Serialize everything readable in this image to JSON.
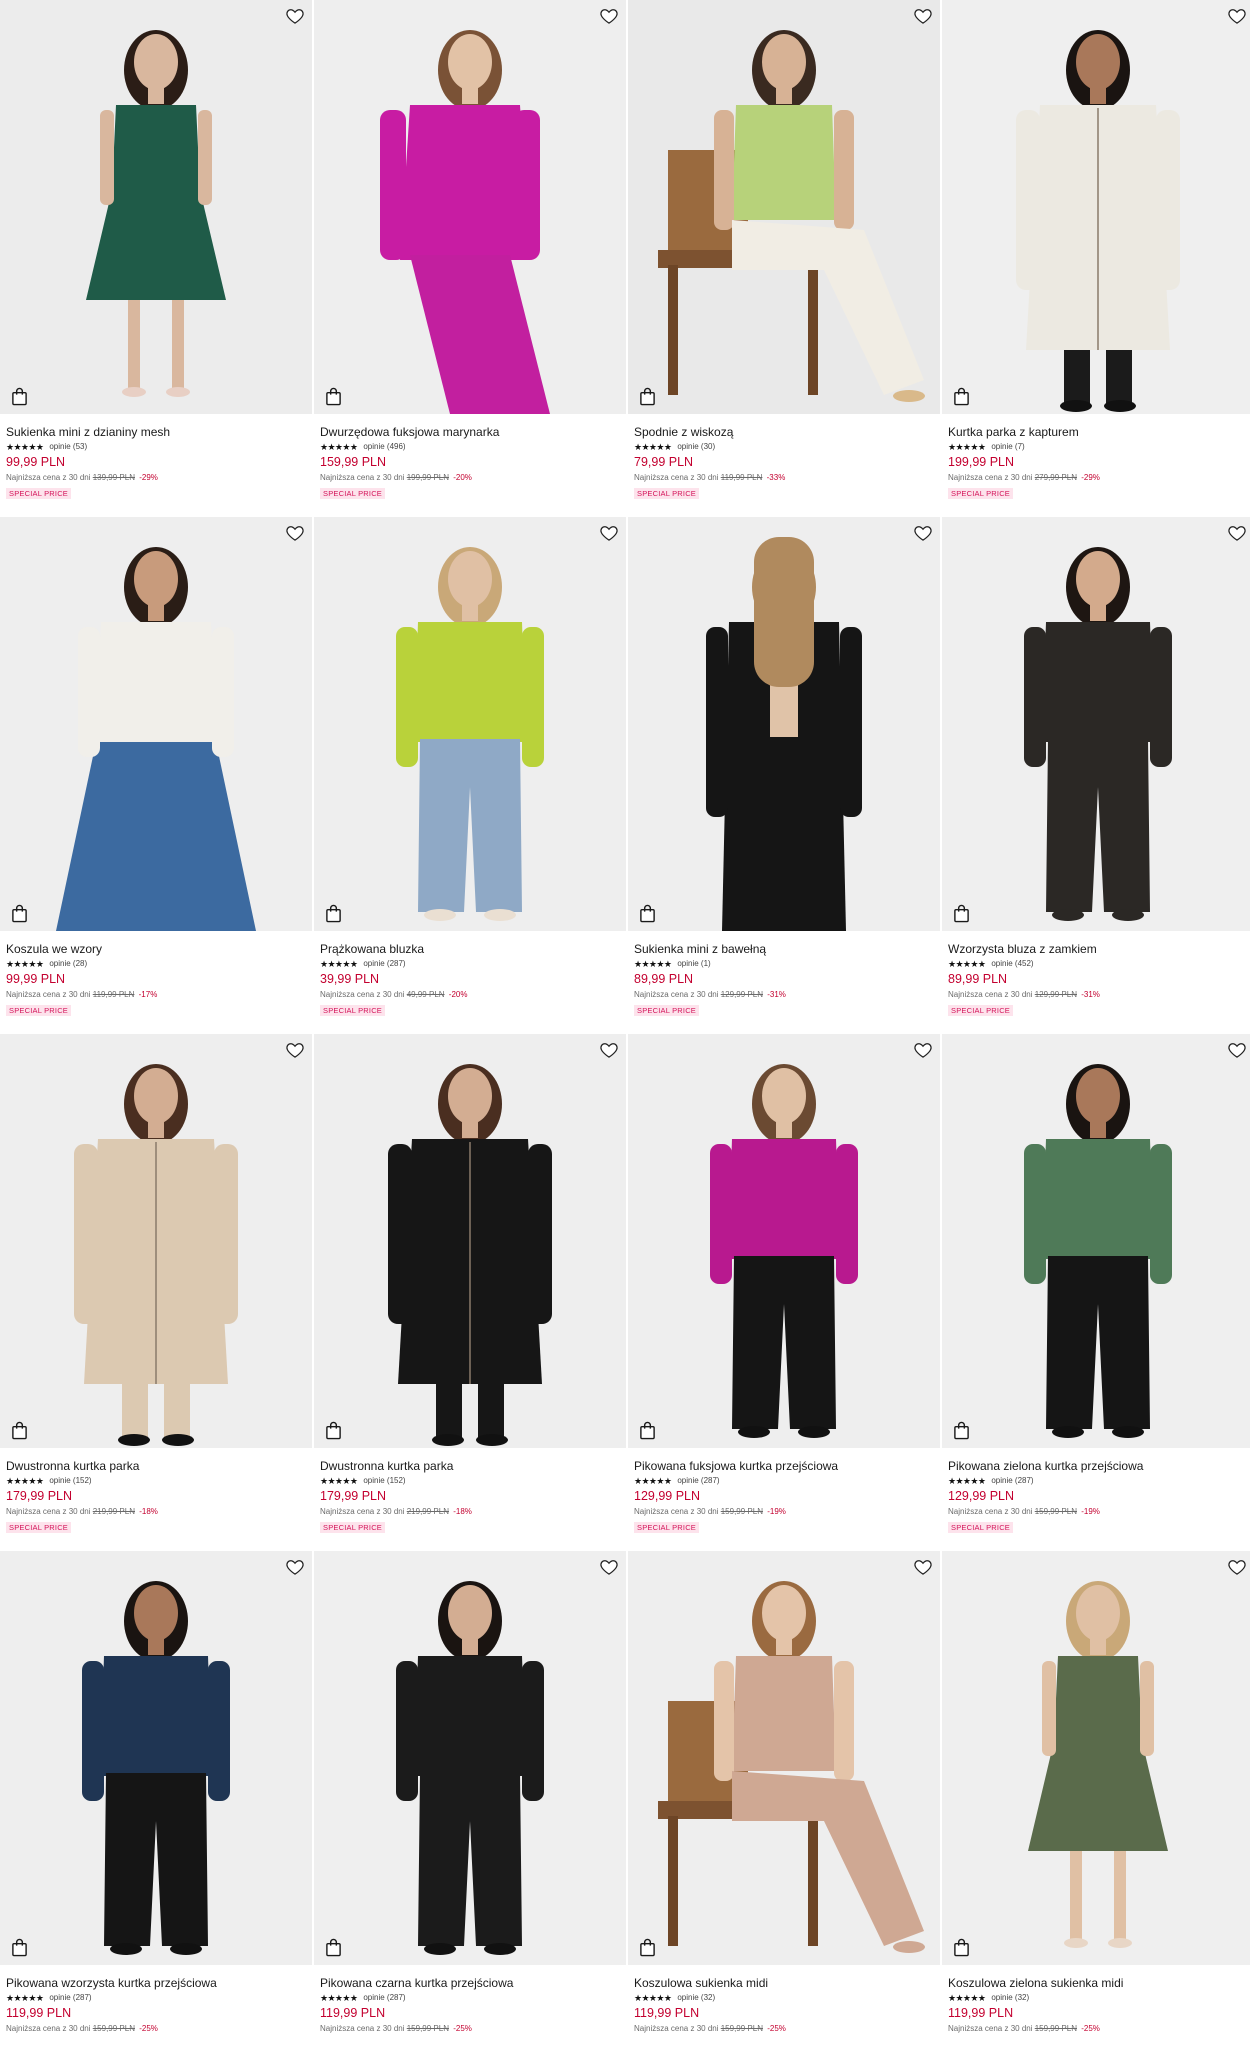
{
  "colors": {
    "price": "#c3002f",
    "badge_text": "#d4145a",
    "badge_bg": "#fde3ec"
  },
  "icons": {
    "wishlist": "heart-outline-icon",
    "cart": "shopping-bag-icon",
    "rating": "star-icon"
  },
  "products": [
    {
      "name": "Sukienka mini z dzianiny mesh",
      "stars": "★★★★★",
      "reviews": "opinie (53)",
      "price": "99,99 PLN",
      "lowest_label": "Najniższa cena z 30 dni",
      "lowest_price": "139,99 PLN",
      "discount": "-29%",
      "badge": "SPECIAL PRICE",
      "bg": "#ececec",
      "top": "#1f5b48",
      "bottom": "#2a6a55",
      "skin": "#d9b79e",
      "hair": "#2b1d16",
      "shoe": "#e8cfc4",
      "pose": "dress"
    },
    {
      "name": "Dwurzędowa fuksjowa marynarka",
      "stars": "★★★★★",
      "reviews": "opinie (496)",
      "price": "159,99 PLN",
      "lowest_label": "Najniższa cena z 30 dni",
      "lowest_price": "199,99 PLN",
      "discount": "-20%",
      "badge": "SPECIAL PRICE",
      "bg": "#eeeeee",
      "top": "#c81ca3",
      "bottom": "#c21f9f",
      "skin": "#e2c2a6",
      "hair": "#7a5236",
      "shoe": "#c21f9f",
      "pose": "lean"
    },
    {
      "name": "Spodnie z wiskozą",
      "stars": "★★★★★",
      "reviews": "opinie (30)",
      "price": "79,99 PLN",
      "lowest_label": "Najniższa cena z 30 dni",
      "lowest_price": "119,99 PLN",
      "discount": "-33%",
      "badge": "SPECIAL PRICE",
      "bg": "#e9e9e9",
      "top": "#b7d27a",
      "bottom": "#f1ede4",
      "skin": "#d7b295",
      "hair": "#3a2a20",
      "shoe": "#d9b98a",
      "pose": "seated"
    },
    {
      "name": "Kurtka parka z kapturem",
      "stars": "★★★★★",
      "reviews": "opinie (7)",
      "price": "199,99 PLN",
      "lowest_label": "Najniższa cena z 30 dni",
      "lowest_price": "279,99 PLN",
      "discount": "-29%",
      "badge": "SPECIAL PRICE",
      "bg": "#efefef",
      "top": "#ece9e1",
      "bottom": "#1b1b1b",
      "skin": "#a9785a",
      "hair": "#1a1411",
      "shoe": "#111111",
      "pose": "coat"
    },
    {
      "name": "Koszula we wzory",
      "stars": "★★★★★",
      "reviews": "opinie (28)",
      "price": "99,99 PLN",
      "lowest_label": "Najniższa cena z 30 dni",
      "lowest_price": "119,99 PLN",
      "discount": "-17%",
      "badge": "SPECIAL PRICE",
      "bg": "#eeeeee",
      "top": "#f1efea",
      "bottom": "#3c6aa0",
      "skin": "#c89b7c",
      "hair": "#2a1d16",
      "shoe": "#3c6aa0",
      "pose": "skirt"
    },
    {
      "name": "Prążkowana bluzka",
      "stars": "★★★★★",
      "reviews": "opinie (287)",
      "price": "39,99 PLN",
      "lowest_label": "Najniższa cena z 30 dni",
      "lowest_price": "49,99 PLN",
      "discount": "-20%",
      "badge": "SPECIAL PRICE",
      "bg": "#eeeeee",
      "top": "#b9d23a",
      "bottom": "#8fa9c6",
      "skin": "#e0c0a4",
      "hair": "#c9a878",
      "shoe": "#eadfd2",
      "pose": "pants"
    },
    {
      "name": "Sukienka mini z bawełną",
      "stars": "★★★★★",
      "reviews": "opinie (1)",
      "price": "89,99 PLN",
      "lowest_label": "Najniższa cena z 30 dni",
      "lowest_price": "129,99 PLN",
      "discount": "-31%",
      "badge": "SPECIAL PRICE",
      "bg": "#eeeeee",
      "top": "#151515",
      "bottom": "#151515",
      "skin": "#e0c3a8",
      "hair": "#b08a5e",
      "shoe": "#151515",
      "pose": "back"
    },
    {
      "name": "Wzorzysta bluza z zamkiem",
      "stars": "★★★★★",
      "reviews": "opinie (452)",
      "price": "89,99 PLN",
      "lowest_label": "Najniższa cena z 30 dni",
      "lowest_price": "129,99 PLN",
      "discount": "-31%",
      "badge": "SPECIAL PRICE",
      "bg": "#efefef",
      "top": "#2b2825",
      "bottom": "#2b2825",
      "skin": "#d3aa8c",
      "hair": "#1e1612",
      "shoe": "#2b2825",
      "pose": "pants"
    },
    {
      "name": "Dwustronna kurtka parka",
      "stars": "★★★★★",
      "reviews": "opinie (152)",
      "price": "179,99 PLN",
      "lowest_label": "Najniższa cena z 30 dni",
      "lowest_price": "219,99 PLN",
      "discount": "-18%",
      "badge": "SPECIAL PRICE",
      "bg": "#eeeeee",
      "top": "#dcc9b1",
      "bottom": "#dcc9b1",
      "skin": "#d3ad92",
      "hair": "#4a2e20",
      "shoe": "#111111",
      "pose": "coat"
    },
    {
      "name": "Dwustronna kurtka parka",
      "stars": "★★★★★",
      "reviews": "opinie (152)",
      "price": "179,99 PLN",
      "lowest_label": "Najniższa cena z 30 dni",
      "lowest_price": "219,99 PLN",
      "discount": "-18%",
      "badge": "SPECIAL PRICE",
      "bg": "#eeeeee",
      "top": "#161616",
      "bottom": "#161616",
      "skin": "#d3ad92",
      "hair": "#4a2e20",
      "shoe": "#111111",
      "pose": "coat"
    },
    {
      "name": "Pikowana fuksjowa kurtka przejściowa",
      "stars": "★★★★★",
      "reviews": "opinie (287)",
      "price": "129,99 PLN",
      "lowest_label": "Najniższa cena z 30 dni",
      "lowest_price": "159,99 PLN",
      "discount": "-19%",
      "badge": "SPECIAL PRICE",
      "bg": "#eeeeee",
      "top": "#b8198f",
      "bottom": "#151515",
      "skin": "#e0c0a4",
      "hair": "#6b4a32",
      "shoe": "#111111",
      "pose": "pants"
    },
    {
      "name": "Pikowana zielona kurtka przejściowa",
      "stars": "★★★★★",
      "reviews": "opinie (287)",
      "price": "129,99 PLN",
      "lowest_label": "Najniższa cena z 30 dni",
      "lowest_price": "159,99 PLN",
      "discount": "-19%",
      "badge": "SPECIAL PRICE",
      "bg": "#efefef",
      "top": "#4f7a58",
      "bottom": "#151515",
      "skin": "#a9785a",
      "hair": "#1a1411",
      "shoe": "#111111",
      "pose": "pants"
    },
    {
      "name": "Pikowana wzorzysta kurtka przejściowa",
      "stars": "★★★★★",
      "reviews": "opinie (287)",
      "price": "119,99 PLN",
      "lowest_label": "Najniższa cena z 30 dni",
      "lowest_price": "159,99 PLN",
      "discount": "-25%",
      "badge": "",
      "bg": "#eeeeee",
      "top": "#1f3553",
      "bottom": "#151515",
      "skin": "#a9785a",
      "hair": "#1a1411",
      "shoe": "#111111",
      "pose": "pants"
    },
    {
      "name": "Pikowana czarna kurtka przejściowa",
      "stars": "★★★★★",
      "reviews": "opinie (287)",
      "price": "119,99 PLN",
      "lowest_label": "Najniższa cena z 30 dni",
      "lowest_price": "159,99 PLN",
      "discount": "-25%",
      "badge": "",
      "bg": "#efefef",
      "top": "#1b1b1b",
      "bottom": "#1b1b1b",
      "skin": "#d3ad92",
      "hair": "#1a1411",
      "shoe": "#111111",
      "pose": "pants"
    },
    {
      "name": "Koszulowa sukienka midi",
      "stars": "★★★★★",
      "reviews": "opinie (32)",
      "price": "119,99 PLN",
      "lowest_label": "Najniższa cena z 30 dni",
      "lowest_price": "159,99 PLN",
      "discount": "-25%",
      "badge": "",
      "bg": "#eeeeee",
      "top": "#cfa893",
      "bottom": "#cfa893",
      "skin": "#e4c4a9",
      "hair": "#9a6a40",
      "shoe": "#cfa893",
      "pose": "seated"
    },
    {
      "name": "Koszulowa zielona sukienka midi",
      "stars": "★★★★★",
      "reviews": "opinie (32)",
      "price": "119,99 PLN",
      "lowest_label": "Najniższa cena z 30 dni",
      "lowest_price": "159,99 PLN",
      "discount": "-25%",
      "badge": "",
      "bg": "#efefef",
      "top": "#5a6b4b",
      "bottom": "#5a6b4b",
      "skin": "#e0c0a4",
      "hair": "#c9a878",
      "shoe": "#e8d6c6",
      "pose": "dress"
    }
  ]
}
